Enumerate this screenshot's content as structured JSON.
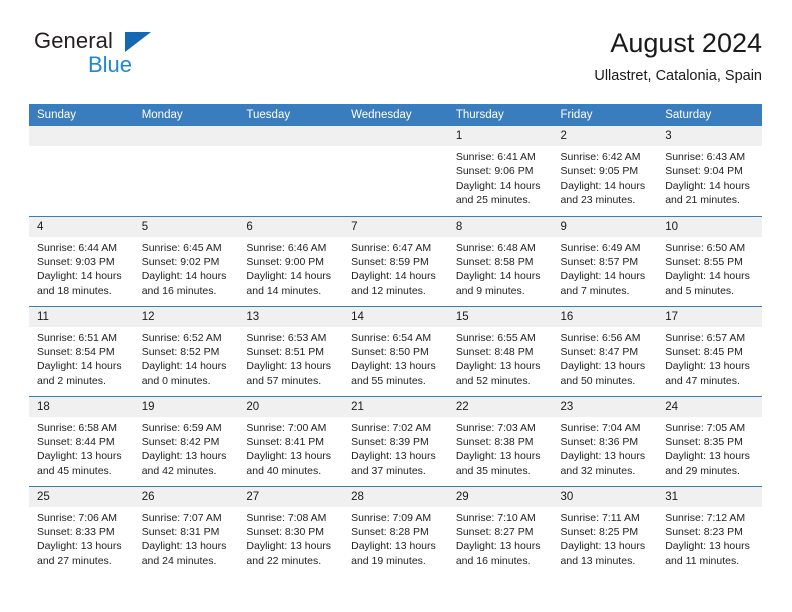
{
  "brand": {
    "word_one": "General",
    "word_two": "Blue",
    "triangle_color": "#1668b3",
    "blue_color": "#1e87d6"
  },
  "header": {
    "title": "August 2024",
    "subtitle": "Ullastret, Catalonia, Spain"
  },
  "theme": {
    "header_bg": "#3a7dbf",
    "daynum_bg": "#f0f0f0",
    "grid_line": "#3a7dbf"
  },
  "weekday_headers": [
    "Sunday",
    "Monday",
    "Tuesday",
    "Wednesday",
    "Thursday",
    "Friday",
    "Saturday"
  ],
  "weeks": [
    [
      {
        "day": "",
        "sunrise": "",
        "sunset": "",
        "daylight_1": "",
        "daylight_2": "",
        "empty": true
      },
      {
        "day": "",
        "sunrise": "",
        "sunset": "",
        "daylight_1": "",
        "daylight_2": "",
        "empty": true
      },
      {
        "day": "",
        "sunrise": "",
        "sunset": "",
        "daylight_1": "",
        "daylight_2": "",
        "empty": true
      },
      {
        "day": "",
        "sunrise": "",
        "sunset": "",
        "daylight_1": "",
        "daylight_2": "",
        "empty": true
      },
      {
        "day": "1",
        "sunrise": "Sunrise: 6:41 AM",
        "sunset": "Sunset: 9:06 PM",
        "daylight_1": "Daylight: 14 hours",
        "daylight_2": "and 25 minutes."
      },
      {
        "day": "2",
        "sunrise": "Sunrise: 6:42 AM",
        "sunset": "Sunset: 9:05 PM",
        "daylight_1": "Daylight: 14 hours",
        "daylight_2": "and 23 minutes."
      },
      {
        "day": "3",
        "sunrise": "Sunrise: 6:43 AM",
        "sunset": "Sunset: 9:04 PM",
        "daylight_1": "Daylight: 14 hours",
        "daylight_2": "and 21 minutes."
      }
    ],
    [
      {
        "day": "4",
        "sunrise": "Sunrise: 6:44 AM",
        "sunset": "Sunset: 9:03 PM",
        "daylight_1": "Daylight: 14 hours",
        "daylight_2": "and 18 minutes."
      },
      {
        "day": "5",
        "sunrise": "Sunrise: 6:45 AM",
        "sunset": "Sunset: 9:02 PM",
        "daylight_1": "Daylight: 14 hours",
        "daylight_2": "and 16 minutes."
      },
      {
        "day": "6",
        "sunrise": "Sunrise: 6:46 AM",
        "sunset": "Sunset: 9:00 PM",
        "daylight_1": "Daylight: 14 hours",
        "daylight_2": "and 14 minutes."
      },
      {
        "day": "7",
        "sunrise": "Sunrise: 6:47 AM",
        "sunset": "Sunset: 8:59 PM",
        "daylight_1": "Daylight: 14 hours",
        "daylight_2": "and 12 minutes."
      },
      {
        "day": "8",
        "sunrise": "Sunrise: 6:48 AM",
        "sunset": "Sunset: 8:58 PM",
        "daylight_1": "Daylight: 14 hours",
        "daylight_2": "and 9 minutes."
      },
      {
        "day": "9",
        "sunrise": "Sunrise: 6:49 AM",
        "sunset": "Sunset: 8:57 PM",
        "daylight_1": "Daylight: 14 hours",
        "daylight_2": "and 7 minutes."
      },
      {
        "day": "10",
        "sunrise": "Sunrise: 6:50 AM",
        "sunset": "Sunset: 8:55 PM",
        "daylight_1": "Daylight: 14 hours",
        "daylight_2": "and 5 minutes."
      }
    ],
    [
      {
        "day": "11",
        "sunrise": "Sunrise: 6:51 AM",
        "sunset": "Sunset: 8:54 PM",
        "daylight_1": "Daylight: 14 hours",
        "daylight_2": "and 2 minutes."
      },
      {
        "day": "12",
        "sunrise": "Sunrise: 6:52 AM",
        "sunset": "Sunset: 8:52 PM",
        "daylight_1": "Daylight: 14 hours",
        "daylight_2": "and 0 minutes."
      },
      {
        "day": "13",
        "sunrise": "Sunrise: 6:53 AM",
        "sunset": "Sunset: 8:51 PM",
        "daylight_1": "Daylight: 13 hours",
        "daylight_2": "and 57 minutes."
      },
      {
        "day": "14",
        "sunrise": "Sunrise: 6:54 AM",
        "sunset": "Sunset: 8:50 PM",
        "daylight_1": "Daylight: 13 hours",
        "daylight_2": "and 55 minutes."
      },
      {
        "day": "15",
        "sunrise": "Sunrise: 6:55 AM",
        "sunset": "Sunset: 8:48 PM",
        "daylight_1": "Daylight: 13 hours",
        "daylight_2": "and 52 minutes."
      },
      {
        "day": "16",
        "sunrise": "Sunrise: 6:56 AM",
        "sunset": "Sunset: 8:47 PM",
        "daylight_1": "Daylight: 13 hours",
        "daylight_2": "and 50 minutes."
      },
      {
        "day": "17",
        "sunrise": "Sunrise: 6:57 AM",
        "sunset": "Sunset: 8:45 PM",
        "daylight_1": "Daylight: 13 hours",
        "daylight_2": "and 47 minutes."
      }
    ],
    [
      {
        "day": "18",
        "sunrise": "Sunrise: 6:58 AM",
        "sunset": "Sunset: 8:44 PM",
        "daylight_1": "Daylight: 13 hours",
        "daylight_2": "and 45 minutes."
      },
      {
        "day": "19",
        "sunrise": "Sunrise: 6:59 AM",
        "sunset": "Sunset: 8:42 PM",
        "daylight_1": "Daylight: 13 hours",
        "daylight_2": "and 42 minutes."
      },
      {
        "day": "20",
        "sunrise": "Sunrise: 7:00 AM",
        "sunset": "Sunset: 8:41 PM",
        "daylight_1": "Daylight: 13 hours",
        "daylight_2": "and 40 minutes."
      },
      {
        "day": "21",
        "sunrise": "Sunrise: 7:02 AM",
        "sunset": "Sunset: 8:39 PM",
        "daylight_1": "Daylight: 13 hours",
        "daylight_2": "and 37 minutes."
      },
      {
        "day": "22",
        "sunrise": "Sunrise: 7:03 AM",
        "sunset": "Sunset: 8:38 PM",
        "daylight_1": "Daylight: 13 hours",
        "daylight_2": "and 35 minutes."
      },
      {
        "day": "23",
        "sunrise": "Sunrise: 7:04 AM",
        "sunset": "Sunset: 8:36 PM",
        "daylight_1": "Daylight: 13 hours",
        "daylight_2": "and 32 minutes."
      },
      {
        "day": "24",
        "sunrise": "Sunrise: 7:05 AM",
        "sunset": "Sunset: 8:35 PM",
        "daylight_1": "Daylight: 13 hours",
        "daylight_2": "and 29 minutes."
      }
    ],
    [
      {
        "day": "25",
        "sunrise": "Sunrise: 7:06 AM",
        "sunset": "Sunset: 8:33 PM",
        "daylight_1": "Daylight: 13 hours",
        "daylight_2": "and 27 minutes."
      },
      {
        "day": "26",
        "sunrise": "Sunrise: 7:07 AM",
        "sunset": "Sunset: 8:31 PM",
        "daylight_1": "Daylight: 13 hours",
        "daylight_2": "and 24 minutes."
      },
      {
        "day": "27",
        "sunrise": "Sunrise: 7:08 AM",
        "sunset": "Sunset: 8:30 PM",
        "daylight_1": "Daylight: 13 hours",
        "daylight_2": "and 22 minutes."
      },
      {
        "day": "28",
        "sunrise": "Sunrise: 7:09 AM",
        "sunset": "Sunset: 8:28 PM",
        "daylight_1": "Daylight: 13 hours",
        "daylight_2": "and 19 minutes."
      },
      {
        "day": "29",
        "sunrise": "Sunrise: 7:10 AM",
        "sunset": "Sunset: 8:27 PM",
        "daylight_1": "Daylight: 13 hours",
        "daylight_2": "and 16 minutes."
      },
      {
        "day": "30",
        "sunrise": "Sunrise: 7:11 AM",
        "sunset": "Sunset: 8:25 PM",
        "daylight_1": "Daylight: 13 hours",
        "daylight_2": "and 13 minutes."
      },
      {
        "day": "31",
        "sunrise": "Sunrise: 7:12 AM",
        "sunset": "Sunset: 8:23 PM",
        "daylight_1": "Daylight: 13 hours",
        "daylight_2": "and 11 minutes."
      }
    ]
  ]
}
